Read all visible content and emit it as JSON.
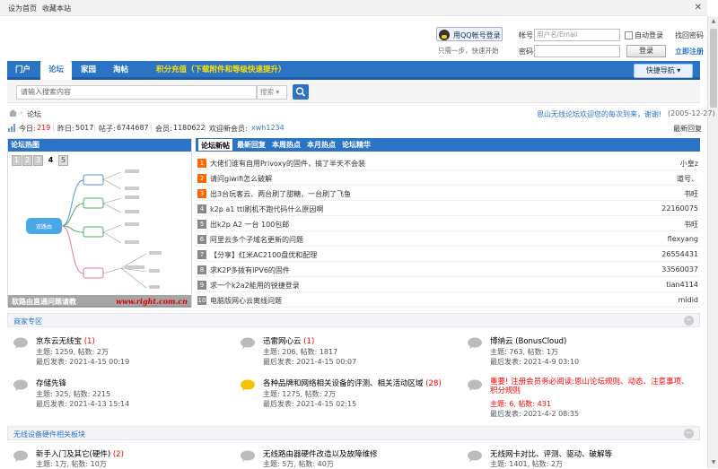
{
  "topbar": {
    "set_home": "设为首页",
    "bookmark": "收藏本站",
    "close": "✕"
  },
  "login": {
    "qq_label": "用QQ帐号登录",
    "qq_tip": "只需一步，快速开始",
    "account_label": "帐号",
    "account_placeholder": "用户名/Email",
    "auto_login": "自动登录",
    "find_password": "找回密码",
    "password_label": "密码",
    "register": "立即注册",
    "login_button": "登录"
  },
  "nav": {
    "items": [
      "门户",
      "论坛",
      "家园",
      "淘帖"
    ],
    "active": "论坛",
    "promo": "积分充值（下载附件和等级快速提升）",
    "quick_nav": "快捷导航 ▾"
  },
  "search": {
    "placeholder": "请输入搜索内容",
    "type": "搜索"
  },
  "breadcrumb": {
    "current": "论坛",
    "welcome": "恩山无线论坛欢迎您的每次到来，谢谢!",
    "date": "(2005-12-27)",
    "latest_reply": "最新回复"
  },
  "stats": {
    "today_label": "今日:",
    "today": "219",
    "yesterday_label": "昨日:",
    "yesterday": "5017",
    "posts_label": "帖子:",
    "posts": "6744687",
    "members_label": "会员:",
    "members": "1180622",
    "new_member_label": "欢迎新会员:",
    "new_member": "xwh1234"
  },
  "hot": {
    "title": "论坛热图",
    "pages": [
      "1",
      "2",
      "3",
      "4",
      "5"
    ],
    "current_page": "4",
    "caption": "软路由直通问题请教",
    "watermark": "www.right.com.cn",
    "mindmap_center": "双路由"
  },
  "latest": {
    "tabs": [
      "论坛新帖",
      "最新回复",
      "本周热点",
      "本月热点",
      "论坛精华"
    ],
    "rows": [
      {
        "n": "1",
        "title": "大佬们谁有自用Privoxy的固件，搞了半天不会装",
        "author": "小皇z"
      },
      {
        "n": "2",
        "title": "请问giwifi怎么破解",
        "author": "道号、"
      },
      {
        "n": "3",
        "title": "出3台玩客云、两台刷了甜糖，一台刷了飞鱼",
        "author": "书旺"
      },
      {
        "n": "4",
        "title": "k2p a1 ttl刷机不跑代码什么原因啊",
        "author": "22160075"
      },
      {
        "n": "5",
        "title": "出k2p A2 一台 100包邮",
        "author": "书旺"
      },
      {
        "n": "6",
        "title": "阿里云多个子域名更新的问题",
        "author": "flexyang"
      },
      {
        "n": "7",
        "title": "【分享】红米AC2100盘优和配理",
        "author": "26554431"
      },
      {
        "n": "8",
        "title": "求K2P多拨有IPV6的固件",
        "author": "33560037"
      },
      {
        "n": "9",
        "title": "求一个k2a2能用的锐捷登录",
        "author": "tian4114"
      },
      {
        "n": "10",
        "title": "电脑版网心云离线问题",
        "author": "midid"
      }
    ]
  },
  "sections": [
    {
      "title": "商家专区",
      "forums": [
        {
          "name": "京东云无线宝",
          "new": "(1)",
          "line1": "主题: 1259, 帖数: 2万",
          "line2": "最后发表: 2021-4-15 00:19"
        },
        {
          "name": "迅雷网心云",
          "new": "(1)",
          "line1": "主题: 206, 帖数: 1817",
          "line2": "最后发表: 2021-4-15 00:07"
        },
        {
          "name": "博纳云 (BonusCloud)",
          "new": "",
          "line1": "主题: 763, 帖数: 1万",
          "line2": "最后发表: 2021-4-9 03:10"
        },
        {
          "name": "存储先锋",
          "new": "",
          "line1": "主题: 325, 帖数: 2215",
          "line2": "最后发表: 2021-4-13 15:14"
        },
        {
          "name": "各种品牌和网络相关设备的评测、相关活动区域",
          "new": "(28)",
          "line1": "主题: 1275, 帖数: 2万",
          "line2": "最后发表: 2021-4-15 02:15"
        },
        {
          "name": "重要! 注册会员务必阅读:恩山论坛规则、动态、注意事项、积分规则",
          "new": "",
          "line1": "主题: 6, 帖数: 431",
          "line2": "最后发表: 2021-4-2 08:35"
        }
      ]
    },
    {
      "title": "无线设备硬件相关板块",
      "forums": [
        {
          "name": "新手入门及其它(硬件)",
          "new": "(2)",
          "line1": "主题: 1万, 帖数: 10万",
          "line2": ""
        },
        {
          "name": "无线路由器硬件改造以及故障维修",
          "new": "",
          "line1": "主题: 5万, 帖数: 40万",
          "line2": ""
        },
        {
          "name": "无线网卡对比、评测、驱动、破解等",
          "new": "",
          "line1": "主题: 1401, 帖数: 2万",
          "line2": ""
        }
      ]
    }
  ],
  "colors": {
    "nav": "#2b74c5",
    "promo": "#ffe000",
    "accent_red": "#f00",
    "hot_num": "#f60"
  }
}
